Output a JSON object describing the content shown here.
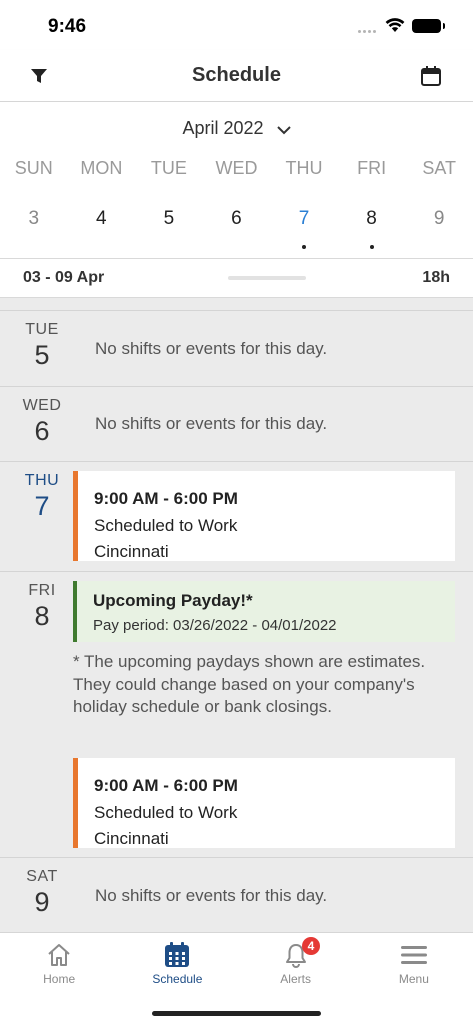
{
  "status_bar": {
    "time": "9:46"
  },
  "header": {
    "title": "Schedule",
    "filter_icon": "filter-icon",
    "calendar_icon": "calendar-icon"
  },
  "week_picker": {
    "month_label": "April 2022",
    "weekdays": [
      "SUN",
      "MON",
      "TUE",
      "WED",
      "THU",
      "FRI",
      "SAT"
    ],
    "dates": [
      "3",
      "4",
      "5",
      "6",
      "7",
      "8",
      "9"
    ],
    "today_color": "#2a7fd4"
  },
  "range": {
    "label": "03 - 09 Apr",
    "hours": "18h"
  },
  "days": {
    "tue": {
      "dow": "TUE",
      "num": "5",
      "empty_text": "No shifts or events for this day."
    },
    "wed": {
      "dow": "WED",
      "num": "6",
      "empty_text": "No shifts or events for this day."
    },
    "thu": {
      "dow": "THU",
      "num": "7",
      "shift": {
        "time": "9:00 AM - 6:00 PM",
        "status": "Scheduled to Work",
        "location": "Cincinnati"
      }
    },
    "fri": {
      "dow": "FRI",
      "num": "8",
      "payday": {
        "title": "Upcoming Payday!*",
        "period": "Pay period: 03/26/2022 - 04/01/2022",
        "note": "* The upcoming paydays shown are estimates. They could change based on your company's holiday schedule or bank closings."
      },
      "shift": {
        "time": "9:00 AM - 6:00 PM",
        "status": "Scheduled to Work",
        "location": "Cincinnati"
      }
    },
    "sat": {
      "dow": "SAT",
      "num": "9",
      "empty_text": "No shifts or events for this day."
    }
  },
  "tabs": {
    "home": "Home",
    "schedule": "Schedule",
    "alerts": "Alerts",
    "alerts_badge": "4",
    "menu": "Menu"
  },
  "colors": {
    "accent": "#1e4d86",
    "shift_bar": "#e8772e",
    "payday_bar": "#3f7a2f",
    "badge": "#e53935"
  }
}
